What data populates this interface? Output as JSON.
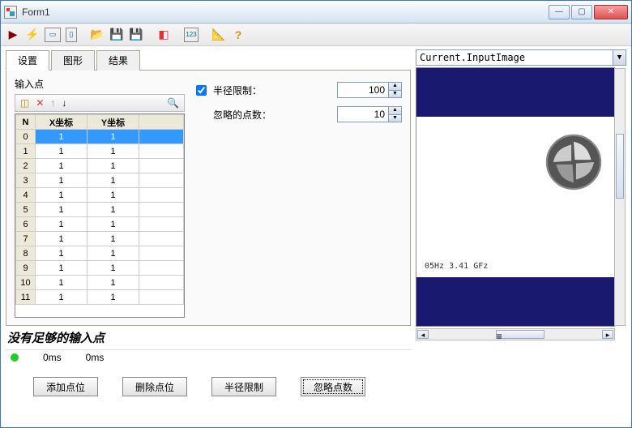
{
  "window": {
    "title": "Form1"
  },
  "tabs": {
    "t0": "设置",
    "t1": "图形",
    "t2": "结果"
  },
  "group": {
    "points_label": "输入点"
  },
  "grid": {
    "cols": {
      "n": "N",
      "x": "X坐标",
      "y": "Y坐标"
    },
    "rows": [
      {
        "n": "0",
        "x": "1",
        "y": "1"
      },
      {
        "n": "1",
        "x": "1",
        "y": "1"
      },
      {
        "n": "2",
        "x": "1",
        "y": "1"
      },
      {
        "n": "3",
        "x": "1",
        "y": "1"
      },
      {
        "n": "4",
        "x": "1",
        "y": "1"
      },
      {
        "n": "5",
        "x": "1",
        "y": "1"
      },
      {
        "n": "6",
        "x": "1",
        "y": "1"
      },
      {
        "n": "7",
        "x": "1",
        "y": "1"
      },
      {
        "n": "8",
        "x": "1",
        "y": "1"
      },
      {
        "n": "9",
        "x": "1",
        "y": "1"
      },
      {
        "n": "10",
        "x": "1",
        "y": "1"
      },
      {
        "n": "11",
        "x": "1",
        "y": "1"
      }
    ]
  },
  "opts": {
    "radius_label": "半径限制：",
    "radius_value": "100",
    "ignore_label": "忽略的点数：",
    "ignore_value": "10"
  },
  "status": {
    "msg": "没有足够的输入点",
    "t1": "0ms",
    "t2": "0ms"
  },
  "image": {
    "combo": "Current.InputImage",
    "caption": "05Hz  3.41 GFz"
  },
  "buttons": {
    "add": "添加点位",
    "del": "删除点位",
    "radius": "半径限制",
    "ignore": "忽略点数"
  },
  "icons": {
    "search": "🔍"
  }
}
